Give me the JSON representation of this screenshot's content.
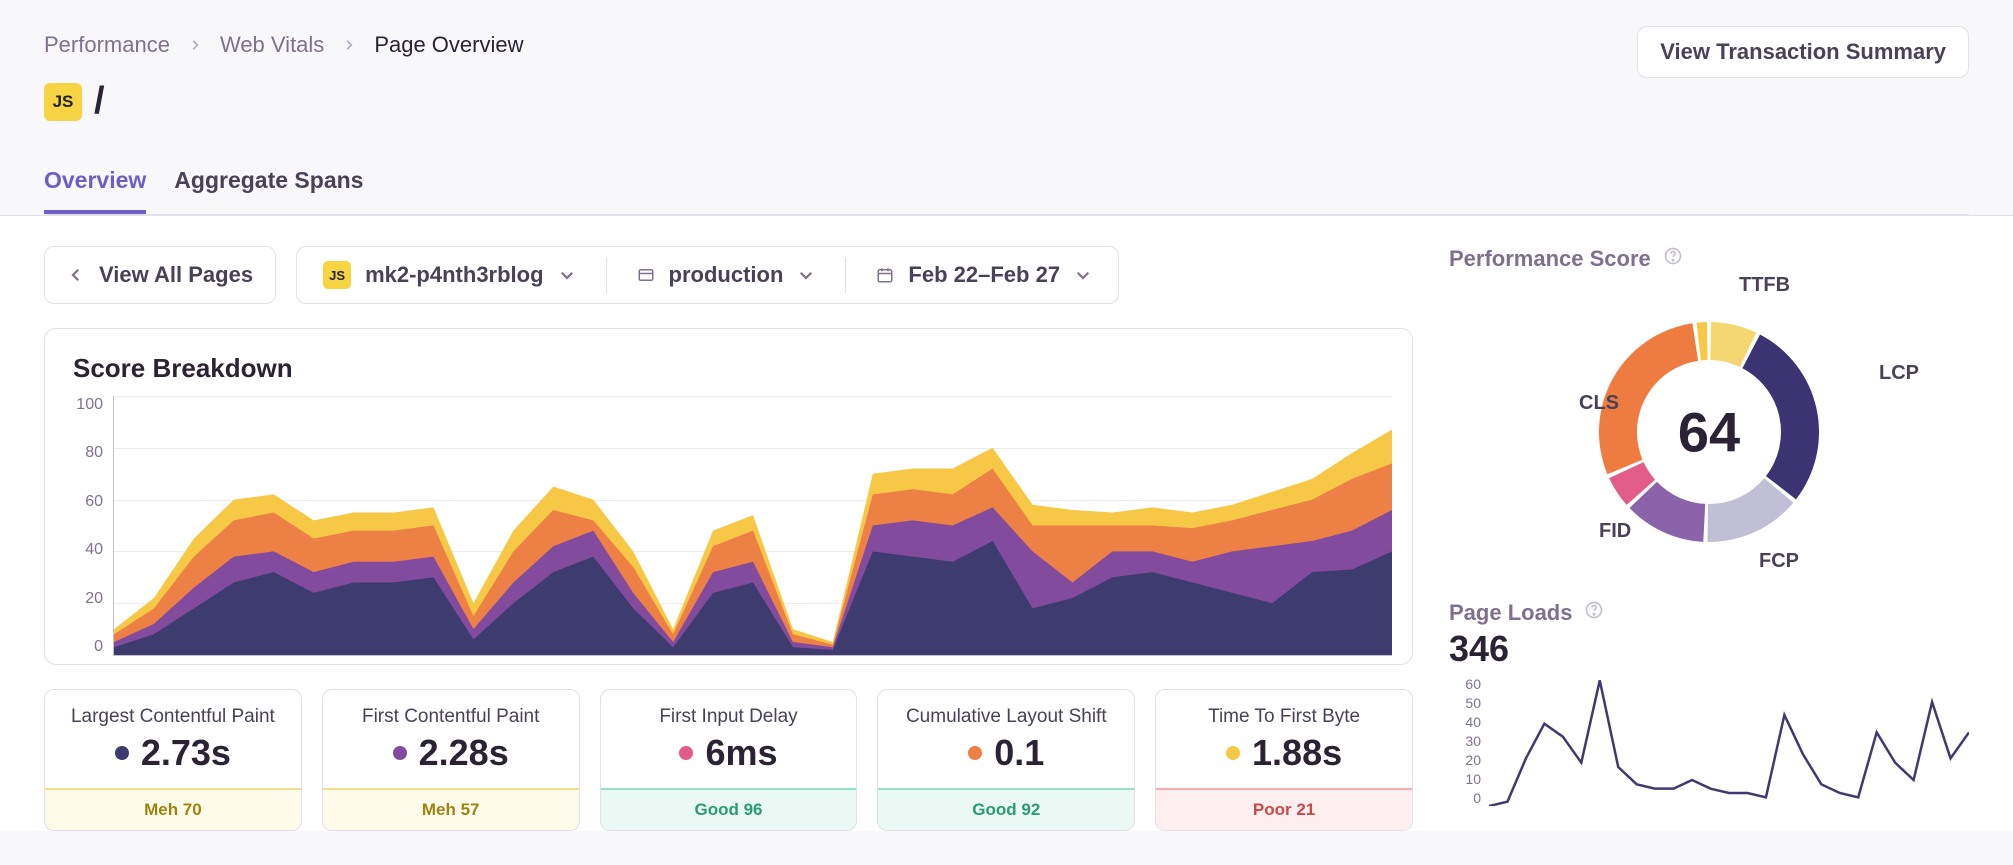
{
  "breadcrumbs": {
    "items": [
      "Performance",
      "Web Vitals",
      "Page Overview"
    ]
  },
  "page": {
    "badge": "JS",
    "title": "/"
  },
  "buttons": {
    "view_summary": "View Transaction Summary",
    "view_all_pages": "View All Pages"
  },
  "tabs": {
    "overview": "Overview",
    "aggregate_spans": "Aggregate Spans",
    "active": "overview"
  },
  "filters": {
    "project": "mk2-p4nth3rblog",
    "environment": "production",
    "date_range": "Feb 22–Feb 27"
  },
  "breakdown_title": "Score Breakdown",
  "performance_score": {
    "title": "Performance Score",
    "value": "64",
    "segments_legend": [
      "TTFB",
      "LCP",
      "FCP",
      "FID",
      "CLS"
    ]
  },
  "page_loads": {
    "title": "Page Loads",
    "value": "346",
    "y_ticks": [
      "60",
      "50",
      "40",
      "30",
      "20",
      "10",
      "0"
    ]
  },
  "cards": [
    {
      "name": "Largest Contentful Paint",
      "value": "2.73s",
      "status": "Meh 70",
      "status_kind": "meh",
      "dot": "#3E3B6E"
    },
    {
      "name": "First Contentful Paint",
      "value": "2.28s",
      "status": "Meh 57",
      "status_kind": "meh",
      "dot": "#824B9E"
    },
    {
      "name": "First Input Delay",
      "value": "6ms",
      "status": "Good 96",
      "status_kind": "good",
      "dot": "#E25C8A"
    },
    {
      "name": "Cumulative Layout Shift",
      "value": "0.1",
      "status": "Good 92",
      "status_kind": "good",
      "dot": "#EC8045"
    },
    {
      "name": "Time To First Byte",
      "value": "1.88s",
      "status": "Poor 21",
      "status_kind": "poor",
      "dot": "#F6C845"
    }
  ],
  "chart_data": [
    {
      "type": "area",
      "title": "Score Breakdown",
      "ylabel": "",
      "ylim": [
        0,
        100
      ],
      "y_ticks": [
        100,
        80,
        60,
        40,
        20,
        0
      ],
      "x_count": 31,
      "series": [
        {
          "name": "Time To First Byte",
          "color": "#F6C845",
          "cum_values": [
            10,
            22,
            45,
            60,
            62,
            52,
            55,
            55,
            57,
            20,
            48,
            65,
            60,
            40,
            10,
            48,
            54,
            10,
            5,
            70,
            72,
            72,
            80,
            58,
            56,
            55,
            57,
            55,
            58,
            63,
            68,
            78,
            87
          ]
        },
        {
          "name": "Cumulative Layout Shift",
          "color": "#EC8045",
          "cum_values": [
            8,
            18,
            38,
            52,
            55,
            45,
            48,
            48,
            50,
            15,
            40,
            56,
            52,
            34,
            8,
            42,
            48,
            8,
            4,
            62,
            64,
            62,
            72,
            50,
            50,
            50,
            50,
            49,
            52,
            56,
            60,
            68,
            74
          ]
        },
        {
          "name": "First Contentful Paint",
          "color": "#824B9E",
          "cum_values": [
            5,
            12,
            26,
            38,
            40,
            32,
            36,
            36,
            38,
            10,
            28,
            42,
            48,
            24,
            5,
            32,
            36,
            5,
            3,
            50,
            52,
            50,
            57,
            40,
            28,
            40,
            40,
            36,
            40,
            42,
            44,
            48,
            56
          ]
        },
        {
          "name": "Largest Contentful Paint",
          "color": "#3E3B6E",
          "cum_values": [
            3,
            8,
            18,
            28,
            32,
            24,
            28,
            28,
            30,
            6,
            20,
            32,
            38,
            18,
            3,
            24,
            28,
            3,
            2,
            40,
            38,
            36,
            44,
            18,
            22,
            30,
            32,
            28,
            24,
            20,
            32,
            33,
            40
          ]
        }
      ]
    },
    {
      "type": "pie",
      "title": "Performance Score",
      "center_value": 64,
      "series": [
        {
          "name": "TTFB",
          "value": 7,
          "color": "#F5D771"
        },
        {
          "name": "LCP",
          "value": 27,
          "color": "#3B3372"
        },
        {
          "name": "FCP",
          "value": 14,
          "color": "#C1BFD6"
        },
        {
          "name": "FCP",
          "value": 12,
          "color": "#8A63A8"
        },
        {
          "name": "FID",
          "value": 5,
          "color": "#E25C8A"
        },
        {
          "name": "CLS",
          "value": 28,
          "color": "#EE7C41"
        },
        {
          "name": "CLS",
          "value": 2,
          "color": "#F6C845"
        }
      ]
    },
    {
      "type": "line",
      "title": "Page Loads",
      "ylim": [
        0,
        60
      ],
      "y_ticks": [
        60,
        50,
        40,
        30,
        20,
        10,
        0
      ],
      "values": [
        0,
        2,
        22,
        38,
        32,
        20,
        58,
        18,
        10,
        8,
        8,
        12,
        8,
        6,
        6,
        4,
        42,
        24,
        10,
        6,
        4,
        34,
        20,
        12,
        48,
        22,
        34
      ]
    }
  ]
}
